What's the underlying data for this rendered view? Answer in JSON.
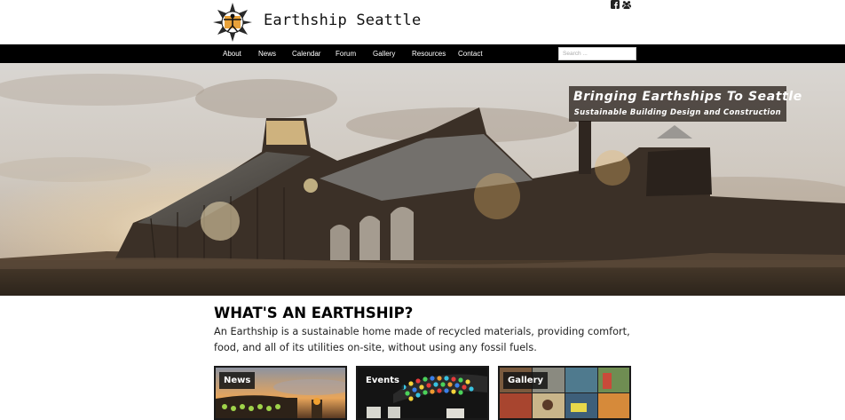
{
  "header": {
    "site_title": "Earthship Seattle",
    "logo_icon": "vitruvian-star-logo",
    "social_icons": [
      "facebook-icon",
      "group-icon"
    ]
  },
  "nav": {
    "items": [
      "About",
      "News",
      "Calendar",
      "Forum",
      "Gallery",
      "Resources",
      "Contact"
    ],
    "search_placeholder": "Search ..."
  },
  "hero": {
    "tagline": "Bringing Earthships To Seattle",
    "subtitle": "Sustainable Building Design and Construction"
  },
  "main": {
    "heading": "WHAT'S AN EARTHSHIP?",
    "intro": "An Earthship is a sustainable home made of recycled materials, providing comfort, food, and all of its utilities on-site, without using any fossil fuels."
  },
  "tiles": [
    {
      "label": "News"
    },
    {
      "label": "Events"
    },
    {
      "label": "Gallery"
    }
  ],
  "colors": {
    "nav_background": "#000000",
    "tile_border": "#1a1a1a"
  }
}
